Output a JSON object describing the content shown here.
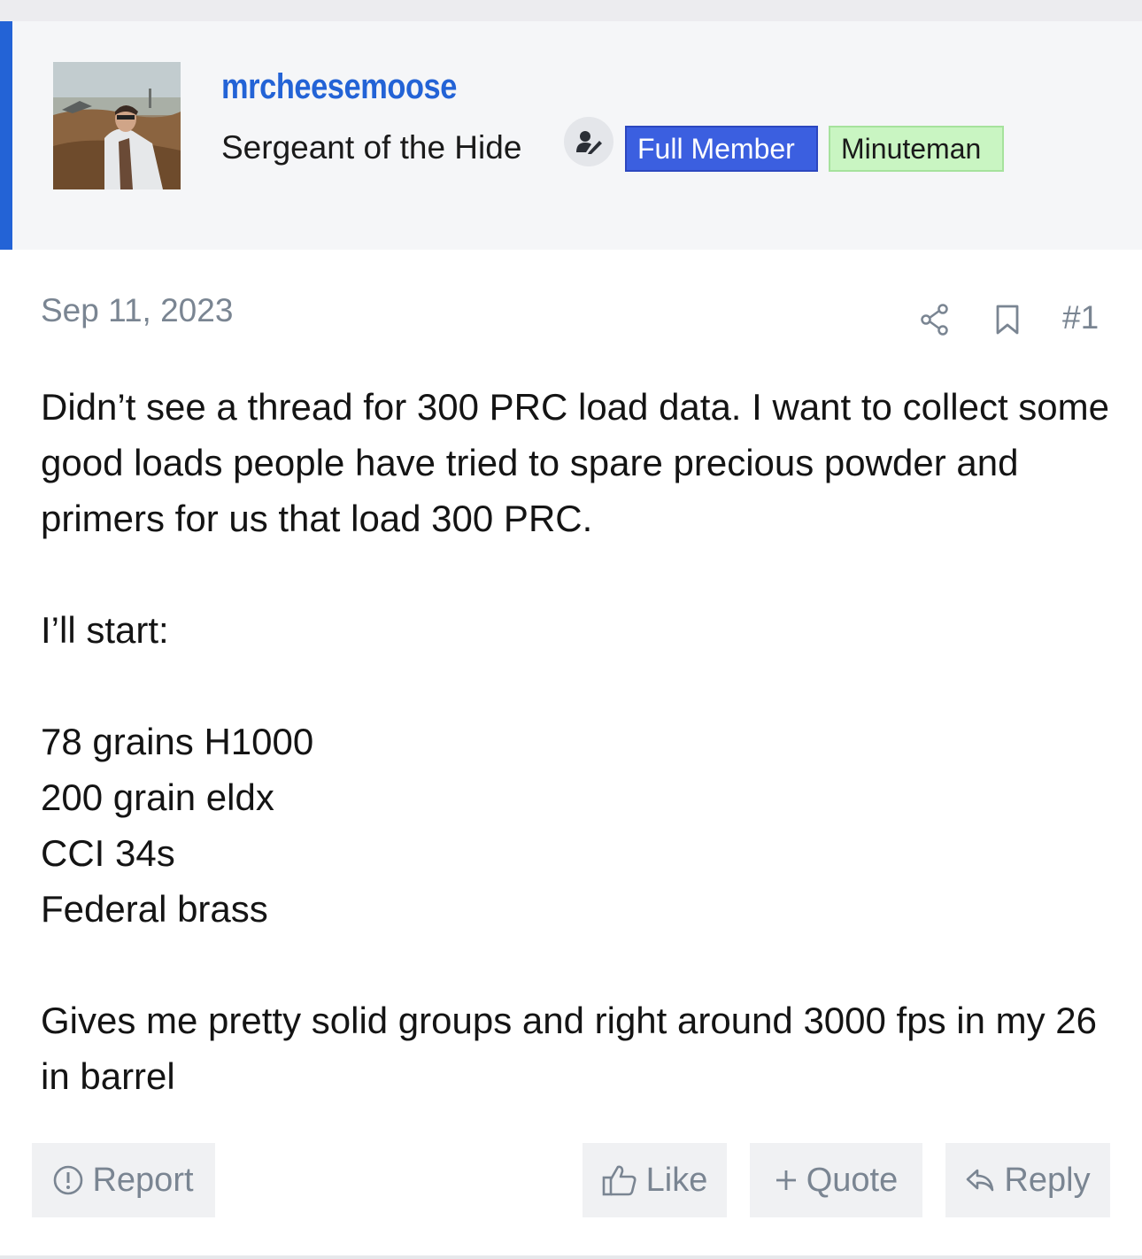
{
  "user": {
    "name": "mrcheesemoose",
    "title": "Sergeant of the Hide",
    "staff_icon": "user-edit-icon",
    "badges": [
      {
        "label": "Full Member",
        "color": "#3b5fe0"
      },
      {
        "label": "Minuteman",
        "color": "#c9f5c2"
      }
    ],
    "accent_color": "#2363d6"
  },
  "post": {
    "date": "Sep 11, 2023",
    "number": "#1",
    "paragraphs": [
      "Didn’t see a thread for 300 PRC load data. I want to collect some good loads people have tried to spare precious powder and primers for us that load 300 PRC.",
      "I’ll start:",
      "78 grains H1000",
      "200 grain eldx",
      "CCI 34s",
      "Federal brass",
      "Gives me pretty solid groups and right around 3000 fps in my 26 in barrel"
    ]
  },
  "actions": {
    "report": "Report",
    "like": "Like",
    "quote": "Quote",
    "reply": "Reply"
  },
  "icons": {
    "share": "share-icon",
    "bookmark": "bookmark-icon",
    "report": "exclamation-circle-icon",
    "like": "thumbs-up-icon",
    "quote": "plus-icon",
    "reply": "reply-arrow-icon"
  }
}
